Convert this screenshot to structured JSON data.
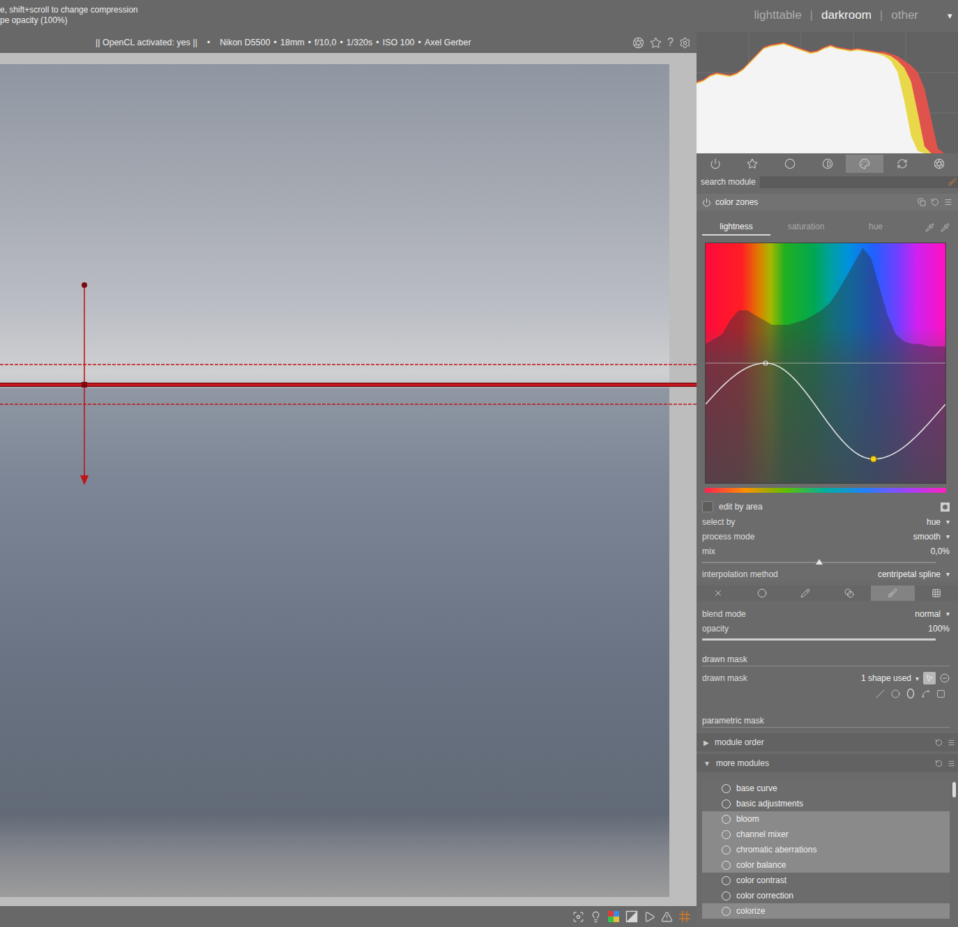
{
  "top_bar": {
    "hints": [
      "e, shift+scroll to change compression",
      "pe opacity (100%)"
    ],
    "views": [
      {
        "label": "lighttable",
        "selected": false
      },
      {
        "label": "darkroom",
        "selected": true
      },
      {
        "label": "other",
        "selected": false
      }
    ],
    "separator": "|",
    "menu": "▾"
  },
  "info_bar": {
    "opencl": "|| OpenCL activated: yes ||",
    "separator": "•",
    "exif": [
      "Nikon D5500",
      "18mm",
      "f/10,0",
      "1/320s",
      "ISO 100",
      "Axel Gerber"
    ],
    "help": "?"
  },
  "photo": {
    "mask_overlay": true
  },
  "histogram": {
    "series": [
      {
        "name": "red",
        "color": "#e0524c",
        "values": [
          0.62,
          0.64,
          0.68,
          0.7,
          0.69,
          0.68,
          0.7,
          0.74,
          0.8,
          0.86,
          0.92,
          0.94,
          0.95,
          0.96,
          0.94,
          0.92,
          0.9,
          0.88,
          0.89,
          0.92,
          0.94,
          0.92,
          0.91,
          0.9,
          0.91,
          0.9,
          0.89,
          0.88,
          0.88,
          0.86,
          0.84,
          0.8,
          0.76,
          0.7,
          0.56,
          0.3,
          0.04,
          0,
          0,
          0
        ]
      },
      {
        "name": "yellow",
        "color": "#e8d84a",
        "values": [
          0.61,
          0.63,
          0.67,
          0.69,
          0.68,
          0.67,
          0.69,
          0.73,
          0.79,
          0.85,
          0.91,
          0.93,
          0.94,
          0.95,
          0.93,
          0.91,
          0.89,
          0.87,
          0.88,
          0.91,
          0.93,
          0.91,
          0.9,
          0.89,
          0.9,
          0.89,
          0.88,
          0.87,
          0.86,
          0.84,
          0.8,
          0.74,
          0.62,
          0.35,
          0.06,
          0,
          0,
          0,
          0,
          0
        ]
      },
      {
        "name": "luminance",
        "color": "#f4f4f4",
        "values": [
          0.6,
          0.62,
          0.66,
          0.68,
          0.67,
          0.66,
          0.68,
          0.72,
          0.78,
          0.84,
          0.9,
          0.92,
          0.93,
          0.94,
          0.92,
          0.9,
          0.88,
          0.86,
          0.87,
          0.9,
          0.92,
          0.9,
          0.89,
          0.88,
          0.89,
          0.88,
          0.87,
          0.86,
          0.84,
          0.8,
          0.7,
          0.45,
          0.15,
          0.02,
          0,
          0,
          0,
          0,
          0,
          0
        ]
      }
    ]
  },
  "module_groups": [
    {
      "selected": false
    },
    {
      "selected": false
    },
    {
      "selected": false
    },
    {
      "selected": false
    },
    {
      "selected": true
    },
    {
      "selected": false
    },
    {
      "selected": false
    }
  ],
  "search": {
    "label": "search module",
    "value": ""
  },
  "module": {
    "title": "color zones",
    "enabled": true,
    "tabs": [
      {
        "label": "lightness",
        "selected": true
      },
      {
        "label": "saturation",
        "selected": false
      },
      {
        "label": "hue",
        "selected": false
      }
    ],
    "graph": {
      "histogram": [
        0.58,
        0.6,
        0.62,
        0.68,
        0.72,
        0.72,
        0.7,
        0.68,
        0.66,
        0.66,
        0.66,
        0.67,
        0.68,
        0.7,
        0.72,
        0.75,
        0.8,
        0.86,
        0.92,
        0.98,
        0.94,
        0.82,
        0.7,
        0.62,
        0.59,
        0.58,
        0.58,
        0.57,
        0.57,
        0.57
      ],
      "nodes": [
        {
          "hue": 0.25,
          "value": 0.5,
          "selected": false
        },
        {
          "hue": 0.7,
          "value": 0.1,
          "selected": true
        }
      ]
    },
    "edit_by_area": {
      "label": "edit by area",
      "checked": false
    },
    "caret": "▾",
    "settings": [
      {
        "kind": "select",
        "label": "select by",
        "value": "hue"
      },
      {
        "kind": "select",
        "label": "process mode",
        "value": "smooth"
      },
      {
        "kind": "centered",
        "label": "mix",
        "value": "0,0%",
        "level": 0.5
      },
      {
        "kind": "select",
        "label": "interpolation method",
        "value": "centripetal spline"
      }
    ]
  },
  "blend": {
    "tabs": [
      {
        "selected": false
      },
      {
        "selected": false
      },
      {
        "selected": false
      },
      {
        "selected": false
      },
      {
        "selected": true
      },
      {
        "selected": false
      }
    ],
    "settings": [
      {
        "kind": "select",
        "label": "blend mode",
        "value": "normal"
      },
      {
        "kind": "slider",
        "label": "opacity",
        "value": "100%",
        "level": 1
      }
    ],
    "drawn_mask": {
      "header": "drawn mask",
      "label": "drawn mask",
      "value": "1 shape used",
      "editing": true
    },
    "parametric_mask": {
      "header": "parametric mask"
    }
  },
  "sections": [
    {
      "label": "module order",
      "arrow": "▶",
      "expanded": false
    },
    {
      "label": "more modules",
      "arrow": "▼",
      "expanded": true
    }
  ],
  "more_modules": [
    {
      "label": "base curve",
      "highlighted": false
    },
    {
      "label": "basic adjustments",
      "highlighted": false
    },
    {
      "label": "bloom",
      "highlighted": true
    },
    {
      "label": "channel mixer",
      "highlighted": true
    },
    {
      "label": "chromatic aberrations",
      "highlighted": true
    },
    {
      "label": "color balance",
      "highlighted": true
    },
    {
      "label": "color contrast",
      "highlighted": false
    },
    {
      "label": "color correction",
      "highlighted": false
    },
    {
      "label": "colorize",
      "highlighted": true
    }
  ]
}
